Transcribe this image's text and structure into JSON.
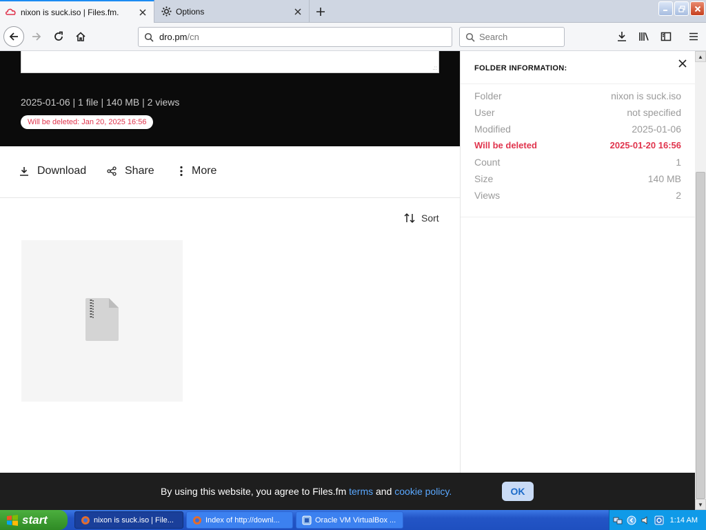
{
  "tabs": [
    {
      "label": "nixon is suck.iso | Files.fm.",
      "icon": "filesfm-logo-icon",
      "active": true
    },
    {
      "label": "Options",
      "icon": "gear-icon",
      "active": false
    }
  ],
  "nav": {
    "url_host": "dro.pm",
    "url_path": "/cn",
    "search_placeholder": "Search"
  },
  "file": {
    "meta": "2025-01-06 | 1 file | 140 MB | 2 views",
    "delete_badge": "Will be deleted: Jan 20, 2025 16:56"
  },
  "actions": {
    "download": "Download",
    "share": "Share",
    "more": "More",
    "sort": "Sort"
  },
  "panel": {
    "title": "FOLDER INFORMATION:",
    "rows": [
      {
        "label": "Folder",
        "value": "nixon is suck.iso"
      },
      {
        "label": "User",
        "value": "not specified"
      },
      {
        "label": "Modified",
        "value": "2025-01-06"
      },
      {
        "label": "Will be deleted",
        "value": "2025-01-20 16:56"
      },
      {
        "label": "Count",
        "value": "1"
      },
      {
        "label": "Size",
        "value": "140 MB"
      },
      {
        "label": "Views",
        "value": "2"
      }
    ]
  },
  "cookie": {
    "text_before": "By using this website, you agree to Files.fm ",
    "terms": "terms",
    "and": " and ",
    "policy": "cookie policy.",
    "ok": "OK"
  },
  "taskbar": {
    "start": "start",
    "items": [
      {
        "label": "nixon is suck.iso | File...",
        "active": true
      },
      {
        "label": "Index of http://downl...",
        "active": false
      },
      {
        "label": "Oracle VM VirtualBox ...",
        "active": false
      }
    ],
    "clock": "1:14 AM"
  },
  "colors": {
    "accent_blue": "#1c8bf2",
    "danger_red": "#e0344d",
    "link_blue": "#5aa8ff"
  }
}
